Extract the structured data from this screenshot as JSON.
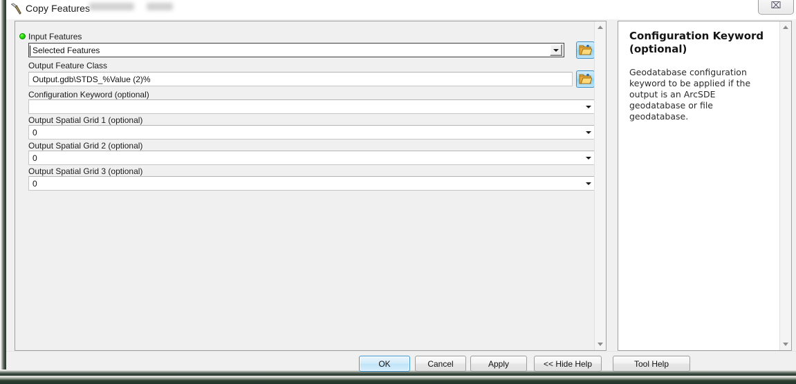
{
  "window": {
    "title": "Copy Features",
    "icon": "hammer-icon",
    "close_label": "⌧"
  },
  "parameters": [
    {
      "label": "Input Features",
      "required": true,
      "control": "combobox",
      "value": "Selected Features",
      "has_browse": true
    },
    {
      "label": "Output Feature Class",
      "required": false,
      "control": "textbox",
      "value": "Output.gdb\\STDS_%Value (2)%",
      "has_browse": true
    },
    {
      "label": "Configuration Keyword (optional)",
      "required": false,
      "control": "combobox-flat",
      "value": "",
      "has_browse": false
    },
    {
      "label": "Output Spatial Grid 1 (optional)",
      "required": false,
      "control": "combobox-flat",
      "value": "0",
      "has_browse": false
    },
    {
      "label": "Output Spatial Grid 2 (optional)",
      "required": false,
      "control": "combobox-flat",
      "value": "0",
      "has_browse": false
    },
    {
      "label": "Output Spatial Grid 3 (optional)",
      "required": false,
      "control": "combobox-flat",
      "value": "0",
      "has_browse": false
    }
  ],
  "help": {
    "title": "Configuration Keyword (optional)",
    "body": "Geodatabase configuration keyword to be applied if the output is an ArcSDE geodatabase or file geodatabase."
  },
  "buttons": {
    "ok": "OK",
    "cancel": "Cancel",
    "apply": "Apply",
    "hide_help": "<< Hide Help",
    "tool_help": "Tool Help"
  },
  "colors": {
    "accent": "#3c94d1",
    "required_indicator": "#26e000",
    "window_bg": "#f0f0f0",
    "field_bg": "#ffffff"
  }
}
